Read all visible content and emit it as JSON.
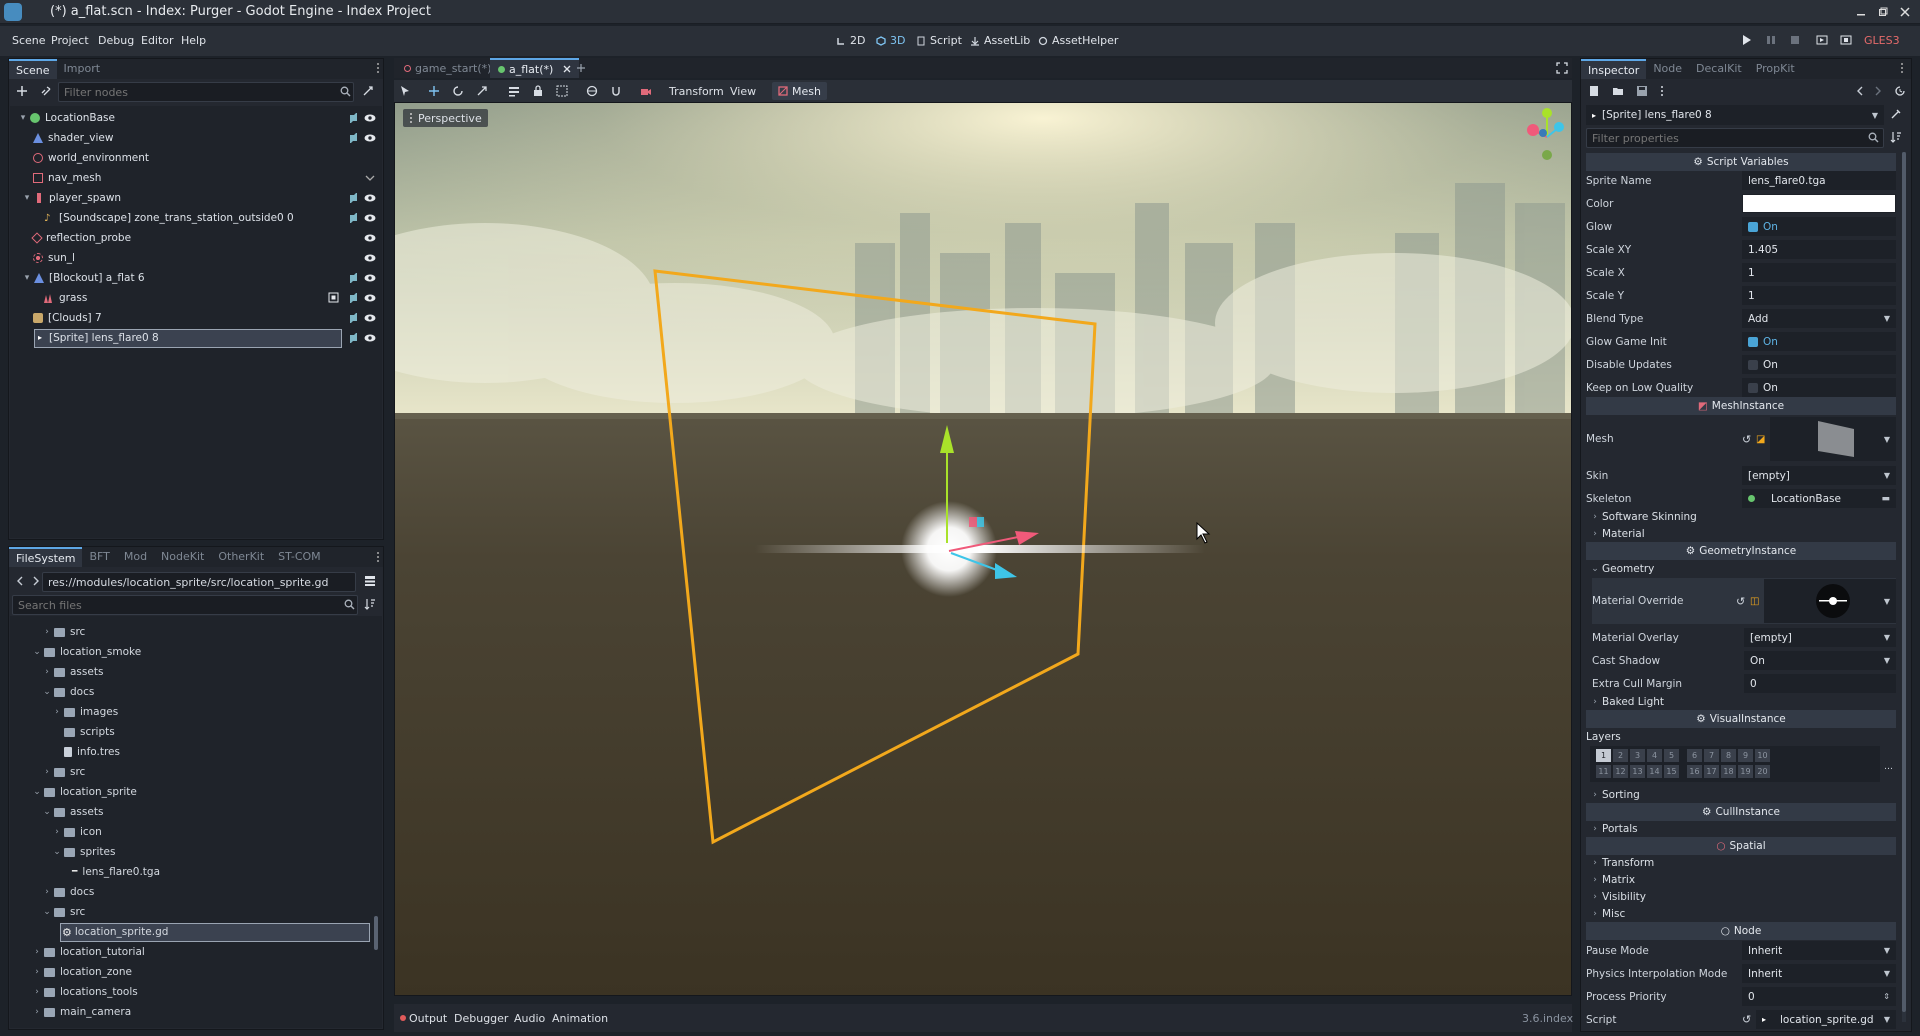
{
  "window": {
    "title": "(*) a_flat.scn - Index: Purger - Godot Engine - Index Project"
  },
  "menu": [
    "Scene",
    "Project",
    "Debug",
    "Editor",
    "Help"
  ],
  "main_buttons": {
    "b2d": "2D",
    "b3d": "3D",
    "script": "Script",
    "assetlib": "AssetLib",
    "assethelper": "AssetHelper"
  },
  "renderer": "GLES3",
  "scene_panel": {
    "tabs": {
      "scene": "Scene",
      "import": "Import"
    },
    "filter_placeholder": "Filter nodes",
    "nodes": [
      {
        "name": "LocationBase"
      },
      {
        "name": "shader_view"
      },
      {
        "name": "world_environment"
      },
      {
        "name": "nav_mesh"
      },
      {
        "name": "player_spawn"
      },
      {
        "name": "[Soundscape] zone_trans_station_outside0 0"
      },
      {
        "name": "reflection_probe"
      },
      {
        "name": "sun_l"
      },
      {
        "name": "[Blockout] a_flat 6"
      },
      {
        "name": "grass"
      },
      {
        "name": "[Clouds] 7"
      },
      {
        "name": "[Sprite] lens_flare0 8"
      }
    ]
  },
  "filesystem": {
    "tabs": {
      "fs": "FileSystem",
      "bft": "BFT",
      "mod": "Mod",
      "nodekit": "NodeKit",
      "otherkit": "OtherKit",
      "stcom": "ST-COM"
    },
    "path": "res://modules/location_sprite/src/location_sprite.gd",
    "search_placeholder": "Search files",
    "items": [
      {
        "name": "src"
      },
      {
        "name": "location_smoke"
      },
      {
        "name": "assets"
      },
      {
        "name": "docs"
      },
      {
        "name": "images"
      },
      {
        "name": "scripts"
      },
      {
        "name": "info.tres"
      },
      {
        "name": "src"
      },
      {
        "name": "location_sprite"
      },
      {
        "name": "assets"
      },
      {
        "name": "icon"
      },
      {
        "name": "sprites"
      },
      {
        "name": "lens_flare0.tga"
      },
      {
        "name": "docs"
      },
      {
        "name": "src"
      },
      {
        "name": "location_sprite.gd"
      },
      {
        "name": "location_tutorial"
      },
      {
        "name": "location_zone"
      },
      {
        "name": "locations_tools"
      },
      {
        "name": "main_camera"
      }
    ]
  },
  "editor_tabs": {
    "t1": "game_start(*)",
    "t2": "a_flat(*)"
  },
  "viewport_toolbar": {
    "transform": "Transform",
    "view": "View",
    "mesh": "Mesh"
  },
  "viewport": {
    "perspective": "Perspective"
  },
  "bottom": {
    "output": "Output",
    "debugger": "Debugger",
    "audio": "Audio",
    "animation": "Animation",
    "version": "3.6.index"
  },
  "inspector": {
    "tabs": {
      "inspector": "Inspector",
      "node": "Node",
      "decalkit": "DecalKit",
      "propkit": "PropKit"
    },
    "object": "[Sprite] lens_flare0 8",
    "filter_placeholder": "Filter properties",
    "sections": {
      "script_vars": "Script Variables",
      "mesh_instance": "MeshInstance",
      "geometry_instance": "GeometryInstance",
      "visual_instance": "VisualInstance",
      "cull_instance": "CullInstance",
      "spatial": "Spatial",
      "node": "Node"
    },
    "props": {
      "sprite_name": {
        "label": "Sprite Name",
        "value": "lens_flare0.tga"
      },
      "color": {
        "label": "Color"
      },
      "glow": {
        "label": "Glow",
        "value": "On"
      },
      "scale_xy": {
        "label": "Scale XY",
        "value": "1.405"
      },
      "scale_x": {
        "label": "Scale X",
        "value": "1"
      },
      "scale_y": {
        "label": "Scale Y",
        "value": "1"
      },
      "blend_type": {
        "label": "Blend Type",
        "value": "Add"
      },
      "glow_game_init": {
        "label": "Glow Game Init",
        "value": "On"
      },
      "disable_updates": {
        "label": "Disable Updates",
        "value": "On"
      },
      "keep_low_quality": {
        "label": "Keep on Low Quality",
        "value": "On"
      },
      "mesh": {
        "label": "Mesh"
      },
      "skin": {
        "label": "Skin",
        "value": "[empty]"
      },
      "skeleton": {
        "label": "Skeleton",
        "value": "LocationBase"
      },
      "material_override": {
        "label": "Material Override"
      },
      "material_overlay": {
        "label": "Material Overlay",
        "value": "[empty]"
      },
      "cast_shadow": {
        "label": "Cast Shadow",
        "value": "On"
      },
      "extra_cull_margin": {
        "label": "Extra Cull Margin",
        "value": "0"
      },
      "layers": {
        "label": "Layers"
      },
      "pause_mode": {
        "label": "Pause Mode",
        "value": "Inherit"
      },
      "physics_interp": {
        "label": "Physics Interpolation Mode",
        "value": "Inherit"
      },
      "process_priority": {
        "label": "Process Priority",
        "value": "0"
      },
      "script": {
        "label": "Script",
        "value": "location_sprite.gd"
      }
    },
    "groups": {
      "software_skinning": "Software Skinning",
      "material": "Material",
      "geometry": "Geometry",
      "baked_light": "Baked Light",
      "sorting": "Sorting",
      "portals": "Portals",
      "transform": "Transform",
      "matrix": "Matrix",
      "visibility": "Visibility",
      "misc": "Misc"
    },
    "layer_bits": [
      "1",
      "2",
      "3",
      "4",
      "5",
      "6",
      "7",
      "8",
      "9",
      "10",
      "11",
      "12",
      "13",
      "14",
      "15",
      "16",
      "17",
      "18",
      "19",
      "20"
    ]
  },
  "colors": {
    "accent": "#5ea7e6",
    "selection_box": "#f2a81c",
    "x_axis": "#f05a7a",
    "y_axis": "#a9e22a",
    "z_axis": "#3ec5e8"
  }
}
